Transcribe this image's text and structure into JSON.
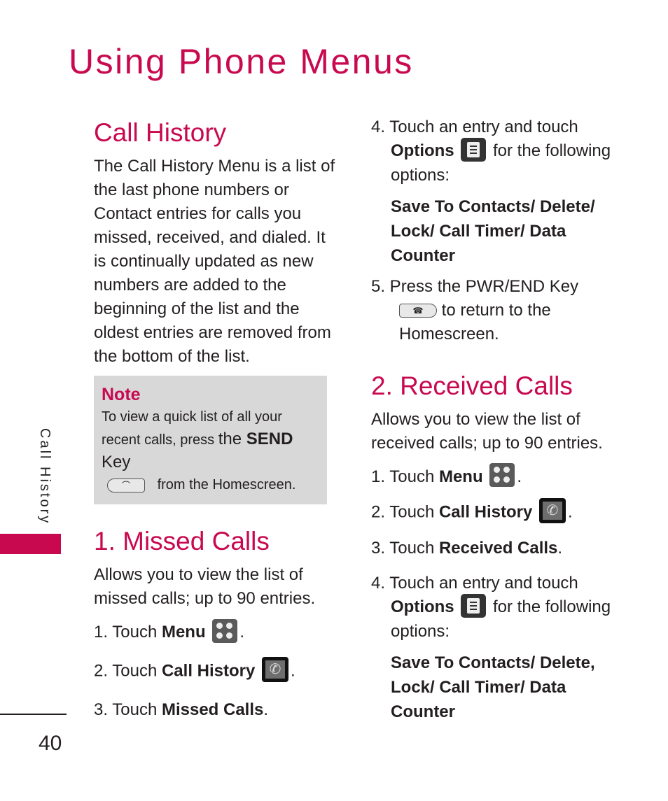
{
  "page_title": "Using Phone Menus",
  "side_tab_label": "Call History",
  "page_number": "40",
  "accent_color": "#c8094f",
  "left": {
    "heading": "Call History",
    "intro": "The Call History Menu is a list of the last phone numbers or Contact entries for calls you missed, received, and dialed. It is continually updated as new numbers are added to the beginning of the list and the oldest entries are removed from the bottom of the list.",
    "note": {
      "title": "Note",
      "line1": "To view a quick list of all your recent calls, press ",
      "the": "the ",
      "send": "SEND",
      "key": " Key",
      "line2": " from the Homescreen.",
      "icon": "send-key-icon"
    },
    "missed": {
      "heading": "1. Missed Calls",
      "desc": "Allows you to view the list of missed calls; up to 90 entries.",
      "steps": [
        {
          "prefix": "1. Touch ",
          "bold": "Menu",
          "icon": "menu-icon",
          "suffix": "."
        },
        {
          "prefix": "2. Touch ",
          "bold": "Call History",
          "icon": "call-history-icon",
          "suffix": "."
        },
        {
          "prefix": "3. Touch ",
          "bold": "Missed Calls",
          "suffix": "."
        }
      ]
    }
  },
  "right": {
    "step4": {
      "prefix": "4. Touch an entry and touch",
      "bold": "Options",
      "icon": "options-icon",
      "suffix": " for the following options:"
    },
    "options1": "Save To Contacts/ Delete/ Lock/ Call Timer/ Data Counter",
    "step5": {
      "prefix": "5. Press the PWR/END Key",
      "icon": "pwr-end-key-icon",
      "suffix": " to return to the Homescreen."
    },
    "received": {
      "heading": "2. Received Calls",
      "desc": "Allows you to view the list of received calls; up to 90 entries.",
      "steps": [
        {
          "prefix": "1. Touch ",
          "bold": "Menu",
          "icon": "menu-icon",
          "suffix": "."
        },
        {
          "prefix": "2. Touch ",
          "bold": "Call History",
          "icon": "call-history-icon",
          "suffix": "."
        },
        {
          "prefix": "3. Touch ",
          "bold": "Received Calls",
          "suffix": "."
        }
      ],
      "step4": {
        "prefix": "4. Touch an entry and touch",
        "bold": "Options",
        "icon": "options-icon",
        "suffix": " for the following options:"
      },
      "options": "Save To Contacts/ Delete, Lock/ Call Timer/ Data Counter"
    }
  }
}
